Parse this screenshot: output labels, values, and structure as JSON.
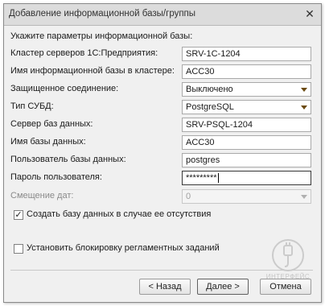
{
  "window": {
    "title": "Добавление информационной базы/группы",
    "close_glyph": "✕",
    "close_icon": "close-icon"
  },
  "form": {
    "heading": "Укажите параметры информационной базы:",
    "cluster": {
      "label": "Кластер серверов 1С:Предприятия:",
      "value": "SRV-1C-1204"
    },
    "ib_name": {
      "label": "Имя информационной базы в кластере:",
      "value": "ACC30"
    },
    "secure_connection": {
      "label": "Защищенное соединение:",
      "value": "Выключено"
    },
    "dbms_type": {
      "label": "Тип СУБД:",
      "value": "PostgreSQL"
    },
    "db_server": {
      "label": "Сервер баз данных:",
      "value": "SRV-PSQL-1204"
    },
    "db_name": {
      "label": "Имя базы данных:",
      "value": "ACC30"
    },
    "db_user": {
      "label": "Пользователь базы данных:",
      "value": "postgres"
    },
    "user_password": {
      "label": "Пароль пользователя:",
      "value": "*********"
    },
    "date_offset": {
      "label": "Смещение дат:",
      "value": "0"
    },
    "create_db": {
      "label": "Создать базу данных в случае ее отсутствия",
      "checked": true,
      "mark": "✓"
    },
    "block_tasks": {
      "label": "Установить блокировку регламентных заданий",
      "checked": false,
      "mark": ""
    }
  },
  "buttons": {
    "back": "< Назад",
    "next": "Далее >",
    "cancel": "Отмена"
  },
  "watermark": {
    "text": "ИНТЕРФЕЙС"
  },
  "colors": {
    "dropdown_arrow": "#6b4a10",
    "window_bg": "#f0f0f0"
  }
}
